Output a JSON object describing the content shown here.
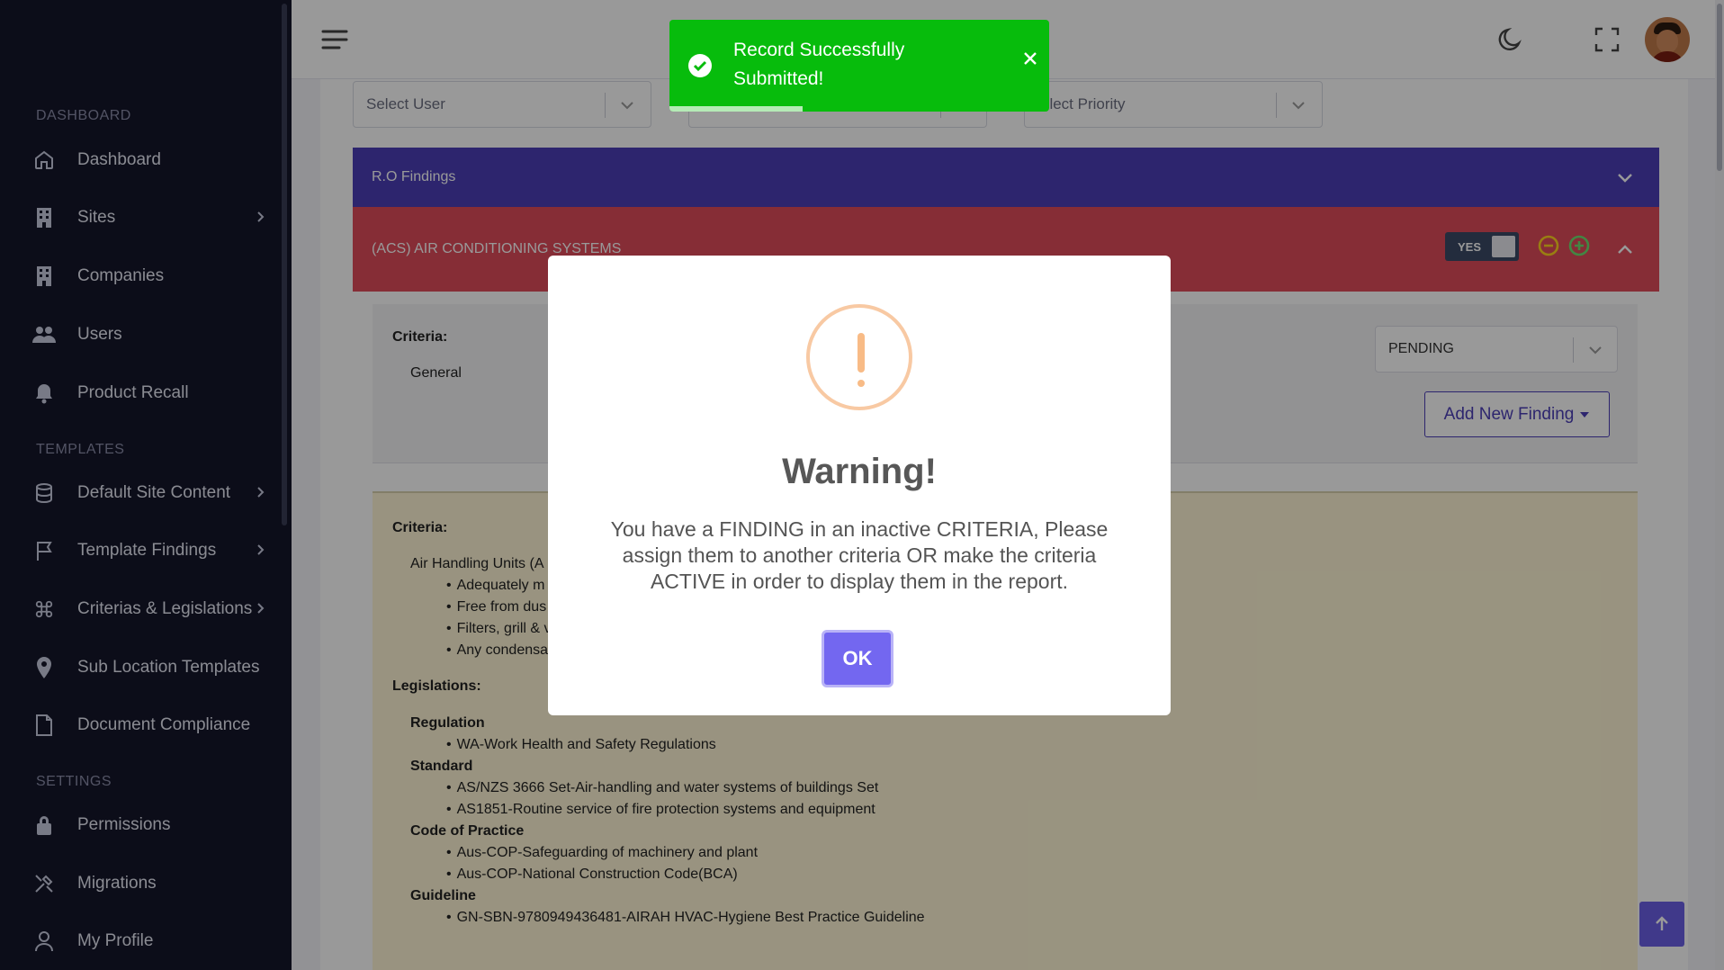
{
  "sidebar": {
    "sections": [
      "DASHBOARD",
      "TEMPLATES",
      "SETTINGS"
    ],
    "items": [
      {
        "label": "Dashboard",
        "icon": "home-icon"
      },
      {
        "label": "Sites",
        "icon": "building-icon",
        "has_children": true
      },
      {
        "label": "Companies",
        "icon": "building-icon"
      },
      {
        "label": "Users",
        "icon": "users-icon"
      },
      {
        "label": "Product Recall",
        "icon": "bell-icon"
      },
      {
        "label": "Default Site Content",
        "icon": "database-icon",
        "has_children": true
      },
      {
        "label": "Template Findings",
        "icon": "flag-icon",
        "has_children": true
      },
      {
        "label": "Criterias & Legislations",
        "icon": "command-icon",
        "has_children": true
      },
      {
        "label": "Sub Location Templates",
        "icon": "map-pin-icon"
      },
      {
        "label": "Document Compliance",
        "icon": "file-icon"
      },
      {
        "label": "Permissions",
        "icon": "lock-icon"
      },
      {
        "label": "Migrations",
        "icon": "tools-icon"
      },
      {
        "label": "My Profile",
        "icon": "user-icon"
      }
    ]
  },
  "filters": {
    "user_placeholder": "Select User",
    "priority_placeholder": "elect Priority"
  },
  "ro_findings": {
    "label": "R.O Findings"
  },
  "acs": {
    "label": "(ACS) AIR CONDITIONING SYSTEMS",
    "toggle_label": "YES"
  },
  "criteria_panel": {
    "heading": "Criteria:",
    "value": "General",
    "status": "PENDING",
    "add_button": "Add New Finding"
  },
  "legislation_panel": {
    "criteria_heading": "Criteria:",
    "criteria_item": "Air Handling Units (A",
    "criteria_bullets": [
      "Adequately m",
      "Free from dus",
      "Filters, grill & v",
      "Any condensa"
    ],
    "legislations_heading": "Legislations:",
    "groups": [
      {
        "title": "Regulation",
        "items": [
          "WA-Work Health and Safety Regulations"
        ]
      },
      {
        "title": "Standard",
        "items": [
          "AS/NZS 3666 Set-Air-handling and water systems of buildings Set",
          "AS1851-Routine service of fire protection systems and equipment"
        ]
      },
      {
        "title": "Code of Practice",
        "items": [
          "Aus-COP-Safeguarding of machinery and plant",
          "Aus-COP-National Construction Code(BCA)"
        ]
      },
      {
        "title": "Guideline",
        "items": [
          "GN-SBN-9780949436481-AIRAH HVAC-Hygiene Best Practice Guideline"
        ]
      }
    ]
  },
  "modal": {
    "title": "Warning!",
    "text": "You have a FINDING in an inactive CRITERIA, Please assign them to another criteria OR make the criteria ACTIVE in order to display them in the report.",
    "ok_label": "OK"
  },
  "toast": {
    "message": "Record Successfully Submitted!",
    "progress": 0.35,
    "color": "#07bc0c"
  },
  "colors": {
    "sidebar": "#14162a",
    "primary": "#7367f0",
    "ro_bar": "#4b3fb8",
    "acs_bar": "#e04b5a"
  }
}
